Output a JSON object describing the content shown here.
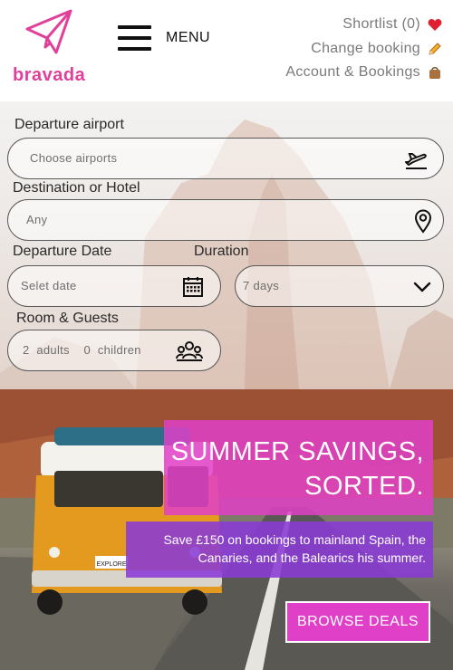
{
  "brand": {
    "name": "bravada",
    "color": "#e0409a"
  },
  "header": {
    "menu_label": "MENU",
    "links": [
      {
        "label": "Shortlist (0)",
        "icon": "heart-icon"
      },
      {
        "label": "Change booking",
        "icon": "pencil-icon"
      },
      {
        "label": "Account & Bookings",
        "icon": "bag-icon"
      }
    ]
  },
  "search": {
    "departure": {
      "label": "Departure  airport",
      "placeholder": "Choose  airports",
      "icon": "plane-departure-icon"
    },
    "destination": {
      "label": "Destination or Hotel",
      "placeholder": "Any",
      "icon": "map-pin-icon"
    },
    "date": {
      "label": "Departure Date",
      "placeholder": "Selet  date",
      "icon": "calendar-icon"
    },
    "duration": {
      "label": "Duration",
      "value": "7  days",
      "icon": "chevron-down-icon"
    },
    "guests": {
      "label": "Room & Guests",
      "value": "2  adults    0  children",
      "icon": "group-icon"
    }
  },
  "promo": {
    "title_line1": "SUMMER SAVINGS,",
    "title_line2": "SORTED.",
    "subtitle": "Save £150 on bookings to mainland Spain, the Canaries, and the Balearics his summer.",
    "cta": "BROWSE DEALS",
    "colors": {
      "pink": "#e040c8",
      "purple": "#8a3ad6"
    }
  },
  "van": {
    "plate": "EXPLORE"
  }
}
